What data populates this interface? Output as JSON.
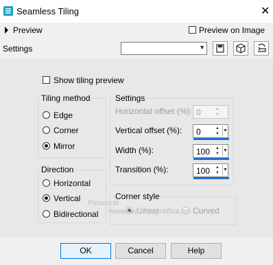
{
  "window": {
    "title": "Seamless Tiling",
    "close_icon": "close-icon",
    "app_icon": "seamless-tiling-icon"
  },
  "preview": {
    "label": "Preview",
    "preview_on_image_label": "Preview on Image",
    "preview_on_image_checked": false
  },
  "settings_row": {
    "label": "Settings",
    "preset_value": "",
    "icons": [
      "save-preset-icon",
      "load-preset-icon",
      "reset-icon"
    ]
  },
  "show_tiling_preview": {
    "label": "Show tiling preview",
    "checked": false
  },
  "tiling_method": {
    "title": "Tiling method",
    "options": [
      "Edge",
      "Corner",
      "Mirror"
    ],
    "selected": "Mirror"
  },
  "direction": {
    "title": "Direction",
    "options": [
      "Horizontal",
      "Vertical",
      "Bidirectional"
    ],
    "selected": "Vertical"
  },
  "settings_group": {
    "title": "Settings",
    "horizontal_offset": {
      "label": "Horizontal offset (%):",
      "value": "0",
      "disabled": true
    },
    "vertical_offset": {
      "label": "Vertical offset (%):",
      "value": "0"
    },
    "width": {
      "label": "Width (%):",
      "value": "100"
    },
    "transition": {
      "label": "Transition (%):",
      "value": "100"
    }
  },
  "corner_style": {
    "title": "Corner style",
    "options": [
      "Linear",
      "Curved"
    ],
    "selected": "Linear",
    "disabled": true
  },
  "buttons": {
    "ok": "OK",
    "cancel": "Cancel",
    "help": "Help"
  },
  "watermark": {
    "line1": "Pinuccia",
    "line2": "www.maidiregrafica.eu"
  },
  "colors": {
    "accent": "#1e6fd0",
    "panel": "#e8e8e8",
    "titlebar": "#ffffff"
  }
}
